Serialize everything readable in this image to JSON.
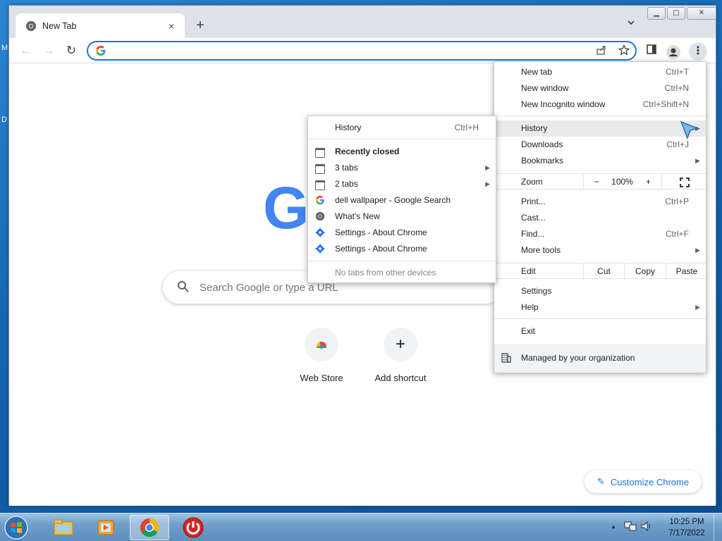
{
  "desktop": {
    "fragments": [
      "M",
      "D"
    ]
  },
  "tab": {
    "title": "New Tab",
    "close": "×"
  },
  "newtab_button": "+",
  "window_buttons": {
    "minimize": "▁",
    "maximize": "▢",
    "close": "✕"
  },
  "toolbar": {
    "back": "←",
    "forward": "→",
    "reload": "↻",
    "omnibox_value": ""
  },
  "page": {
    "search_placeholder": "Search Google or type a URL",
    "shortcuts": [
      {
        "label": "Web Store",
        "icon": "web-store-icon"
      },
      {
        "label": "Add shortcut",
        "icon": "plus-icon",
        "glyph": "+"
      }
    ],
    "customize_label": "Customize Chrome"
  },
  "menu": {
    "new_tab": {
      "label": "New tab",
      "shortcut": "Ctrl+T"
    },
    "new_window": {
      "label": "New window",
      "shortcut": "Ctrl+N"
    },
    "new_incognito": {
      "label": "New Incognito window",
      "shortcut": "Ctrl+Shift+N"
    },
    "history": {
      "label": "History"
    },
    "downloads": {
      "label": "Downloads",
      "shortcut": "Ctrl+J"
    },
    "bookmarks": {
      "label": "Bookmarks"
    },
    "zoom": {
      "label": "Zoom",
      "minus": "−",
      "level": "100%",
      "plus": "+"
    },
    "print": {
      "label": "Print...",
      "shortcut": "Ctrl+P"
    },
    "cast": {
      "label": "Cast..."
    },
    "find": {
      "label": "Find...",
      "shortcut": "Ctrl+F"
    },
    "more_tools": {
      "label": "More tools"
    },
    "edit": {
      "label": "Edit",
      "cut": "Cut",
      "copy": "Copy",
      "paste": "Paste"
    },
    "settings": {
      "label": "Settings"
    },
    "help": {
      "label": "Help"
    },
    "exit": {
      "label": "Exit"
    },
    "managed": {
      "label": "Managed by your organization"
    }
  },
  "history_submenu": {
    "title": {
      "label": "History",
      "shortcut": "Ctrl+H"
    },
    "recently_closed": "Recently closed",
    "items": [
      {
        "label": "3 tabs",
        "icon": "tab-group-icon",
        "has_arrow": true
      },
      {
        "label": "2 tabs",
        "icon": "tab-group-icon",
        "has_arrow": true
      },
      {
        "label": "dell wallpaper - Google Search",
        "icon": "google-icon"
      },
      {
        "label": "What's New",
        "icon": "chrome-icon"
      },
      {
        "label": "Settings - About Chrome",
        "icon": "settings-gear-icon"
      },
      {
        "label": "Settings - About Chrome",
        "icon": "settings-gear-icon"
      }
    ],
    "no_tabs": "No tabs from other devices"
  },
  "taskbar": {
    "clock_time": "10:25 PM",
    "clock_date": "7/17/2022",
    "tray_arrow": "▲"
  },
  "colors": {
    "accent": "#1a73e8",
    "google_blue": "#4285f4",
    "taskbar": "#6f9fc9"
  }
}
